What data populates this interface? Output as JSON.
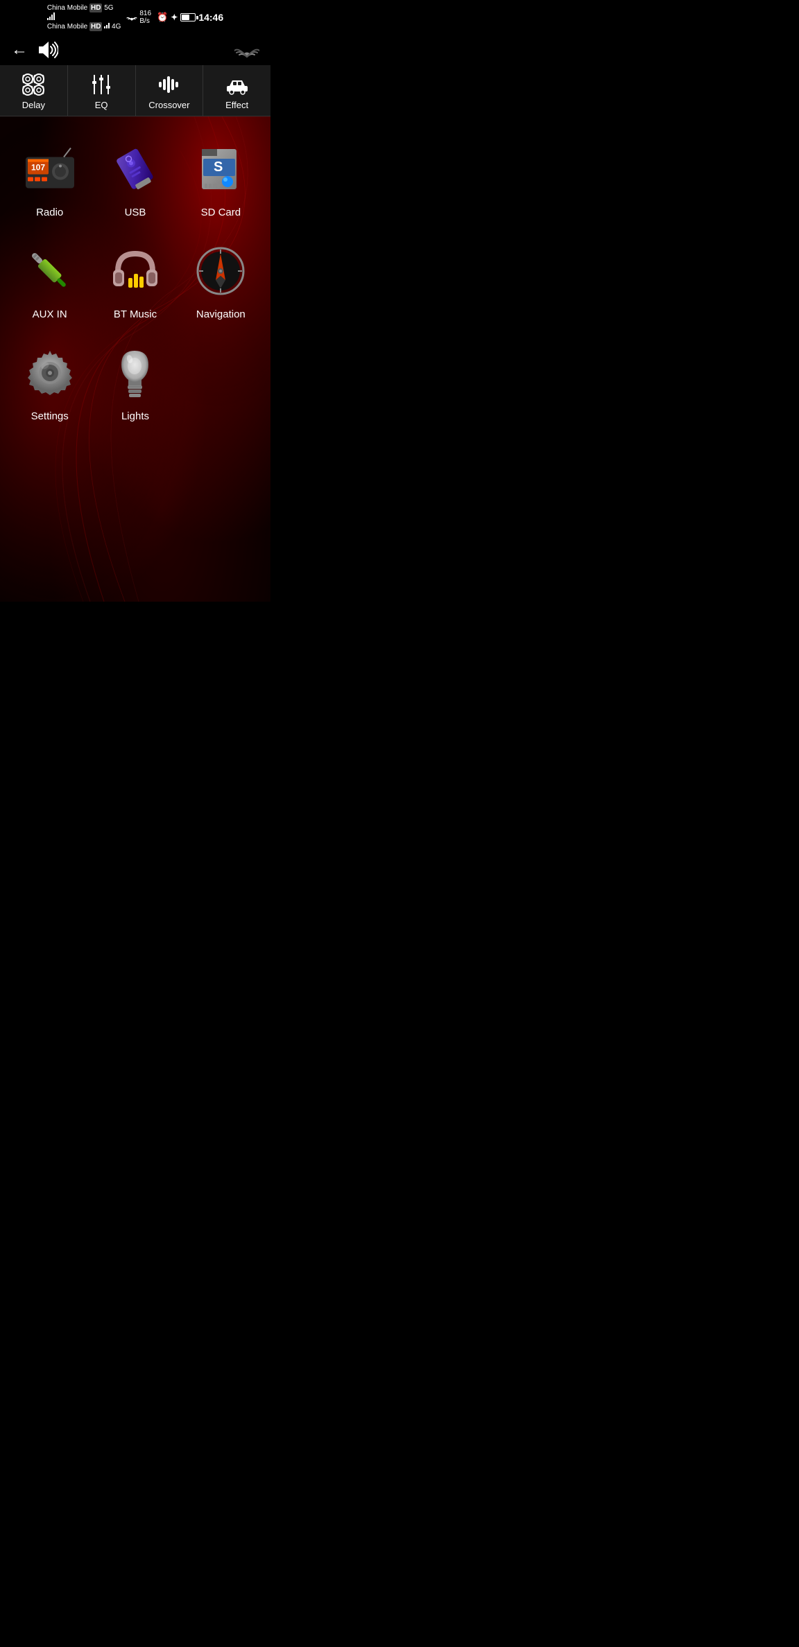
{
  "statusBar": {
    "carrier1": "China Mobile",
    "carrier2": "China Mobile",
    "network": "5G",
    "network2": "4G",
    "speed": "816",
    "speedUnit": "B/s",
    "time": "14:46",
    "batteryPercent": "61"
  },
  "topNav": {
    "backLabel": "←",
    "volumeLabel": "🔊"
  },
  "tabs": [
    {
      "id": "delay",
      "label": "Delay"
    },
    {
      "id": "eq",
      "label": "EQ"
    },
    {
      "id": "crossover",
      "label": "Crossover"
    },
    {
      "id": "effect",
      "label": "Effect"
    }
  ],
  "apps": [
    {
      "id": "radio",
      "label": "Radio"
    },
    {
      "id": "usb",
      "label": "USB"
    },
    {
      "id": "sdcard",
      "label": "SD Card"
    },
    {
      "id": "auxin",
      "label": "AUX IN"
    },
    {
      "id": "btmusic",
      "label": "BT Music"
    },
    {
      "id": "navigation",
      "label": "Navigation"
    },
    {
      "id": "settings",
      "label": "Settings"
    },
    {
      "id": "lights",
      "label": "Lights"
    }
  ],
  "colors": {
    "background": "#000000",
    "tabBar": "#1a1a1a",
    "accentRed": "#8b0000",
    "textWhite": "#ffffff"
  }
}
